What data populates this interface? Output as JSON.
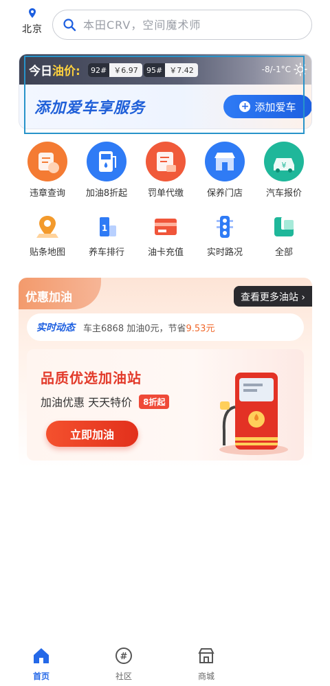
{
  "header": {
    "city": "北京",
    "search_placeholder": "本田CRV，空间魔术师"
  },
  "oil_card": {
    "title_prefix": "今日",
    "title_highlight": "油价:",
    "prices": [
      {
        "grade": "92#",
        "price": "￥6.97"
      },
      {
        "grade": "95#",
        "price": "￥7.42"
      }
    ],
    "weather": "-8/-1°C",
    "slogan": "添加爱车享服务",
    "add_button": "添加爱车"
  },
  "grid": [
    {
      "label": "违章查询",
      "icon": "violation-query-icon",
      "color": "#f47b33"
    },
    {
      "label": "加油8折起",
      "icon": "fuel-discount-icon",
      "color": "#2f7bf5"
    },
    {
      "label": "罚单代缴",
      "icon": "ticket-payment-icon",
      "color": "#f05a3a"
    },
    {
      "label": "保养门店",
      "icon": "maintenance-store-icon",
      "color": "#2f7bf5"
    },
    {
      "label": "汽车报价",
      "icon": "car-price-icon",
      "color": "#1fb79a"
    },
    {
      "label": "贴条地图",
      "icon": "ticket-map-icon",
      "color": "#f39a2c"
    },
    {
      "label": "养车排行",
      "icon": "ranking-icon",
      "color": "#2f7bf5"
    },
    {
      "label": "油卡充值",
      "icon": "fuel-card-icon",
      "color": "#f0553a"
    },
    {
      "label": "实时路况",
      "icon": "traffic-light-icon",
      "color": "#2f7bf5"
    },
    {
      "label": "全部",
      "icon": "all-services-icon",
      "color": "#1fb79a"
    }
  ],
  "promo": {
    "tab_label": "优惠加油",
    "more_label": "查看更多油站",
    "live_tag": "实时动态",
    "live_text": "车主6868 加油0元，节省",
    "live_savings": "9.53元",
    "station_title": "品质优选加油站",
    "station_sub": "加油优惠  天天特价",
    "discount_badge": "8折起",
    "refuel_button": "立即加油"
  },
  "tabbar": [
    {
      "label": "首页",
      "icon": "home-icon",
      "active": true
    },
    {
      "label": "社区",
      "icon": "community-icon",
      "active": false
    },
    {
      "label": "商城",
      "icon": "store-icon",
      "active": false
    }
  ],
  "colors": {
    "brand_blue": "#2569e8",
    "accent_red": "#e23a2a",
    "price_yellow": "#ffd23d"
  }
}
